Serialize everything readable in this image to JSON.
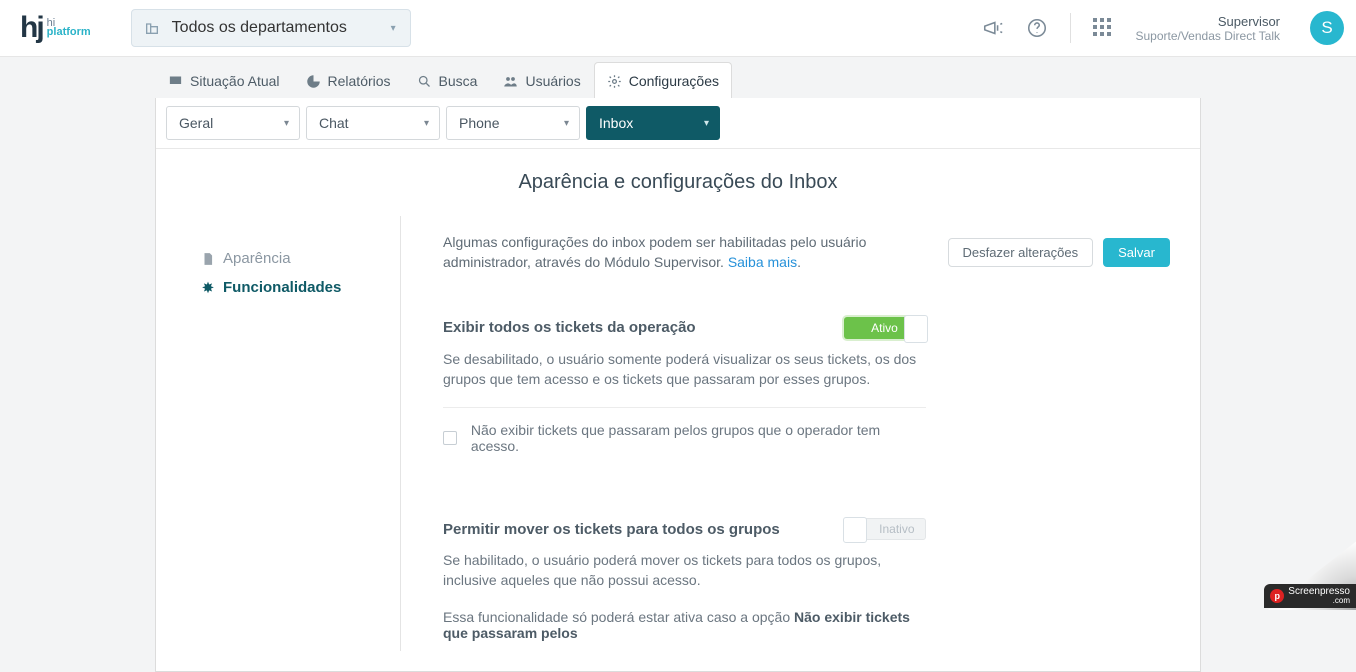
{
  "header": {
    "dept_label": "Todos os departamentos",
    "user_role": "Supervisor",
    "user_org": "Suporte/Vendas Direct Talk",
    "avatar_initial": "S"
  },
  "tabs": [
    {
      "label": "Situação Atual"
    },
    {
      "label": "Relatórios"
    },
    {
      "label": "Busca"
    },
    {
      "label": "Usuários"
    },
    {
      "label": "Configurações"
    }
  ],
  "filters": {
    "geral": "Geral",
    "chat": "Chat",
    "phone": "Phone",
    "inbox": "Inbox"
  },
  "page_title": "Aparência e configurações do Inbox",
  "sidebar": {
    "aparencia": "Aparência",
    "funcionalidades": "Funcionalidades"
  },
  "info": {
    "text": "Algumas configurações do inbox podem ser habilitadas pelo usuário administrador, através do Módulo Supervisor.  ",
    "link": "Saiba mais",
    "dot": "."
  },
  "settings": {
    "s1": {
      "title": "Exibir todos os tickets da operação",
      "toggle_label": "Ativo",
      "desc": "Se desabilitado, o usuário somente poderá visualizar os seus tickets, os dos grupos que tem acesso e os tickets que passaram por esses grupos.",
      "checkbox": "Não exibir tickets que passaram pelos grupos que o operador tem acesso."
    },
    "s2": {
      "title": "Permitir mover os tickets para todos os grupos",
      "toggle_label": "Inativo",
      "desc": "Se habilitado, o usuário poderá mover os tickets para todos os grupos, inclusive aqueles que não possui acesso.",
      "note_prefix": "Essa funcionalidade só poderá estar ativa caso a opção ",
      "note_bold": "Não exibir tickets que passaram pelos"
    }
  },
  "actions": {
    "undo": "Desfazer alterações",
    "save": "Salvar"
  },
  "watermark": {
    "brand": "Screenpresso",
    "suffix": ".com"
  }
}
